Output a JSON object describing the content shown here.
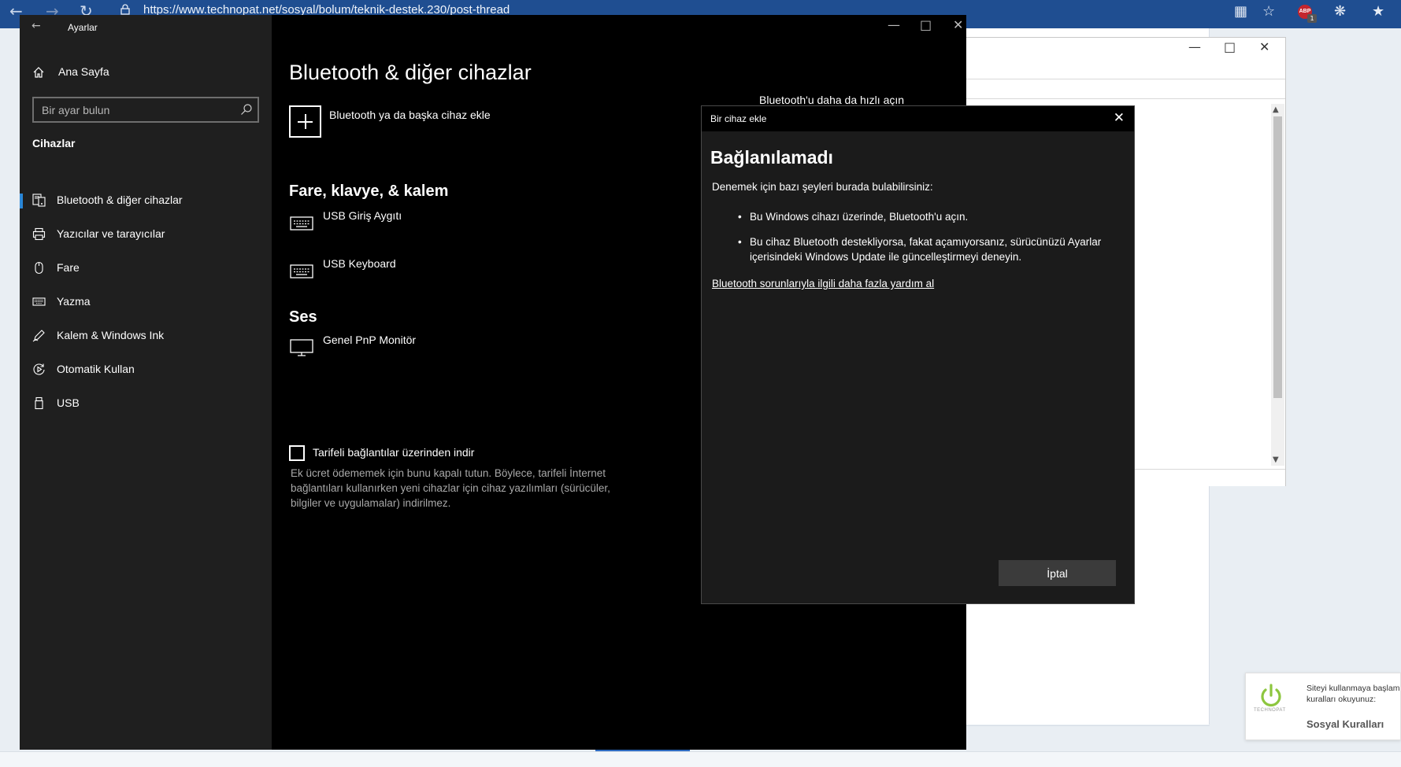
{
  "browser": {
    "url": "https://www.technopat.net/sosyal/bolum/teknik-destek.230/post-thread",
    "abp_label": "ABP",
    "abp_count": "1"
  },
  "settings": {
    "window_title": "Ayarlar",
    "home_label": "Ana Sayfa",
    "search_placeholder": "Bir ayar bulun",
    "group_label": "Cihazlar",
    "nav": [
      {
        "label": "Bluetooth & diğer cihazlar",
        "icon": "bluetooth-devices-icon",
        "selected": true
      },
      {
        "label": "Yazıcılar ve tarayıcılar",
        "icon": "printer-icon",
        "selected": false
      },
      {
        "label": "Fare",
        "icon": "mouse-icon",
        "selected": false
      },
      {
        "label": "Yazma",
        "icon": "keyboard-icon",
        "selected": false
      },
      {
        "label": "Kalem & Windows Ink",
        "icon": "pen-icon",
        "selected": false
      },
      {
        "label": "Otomatik Kullan",
        "icon": "autoplay-icon",
        "selected": false
      },
      {
        "label": "USB",
        "icon": "usb-icon",
        "selected": false
      }
    ],
    "main": {
      "title": "Bluetooth & diğer cihazlar",
      "add_device_label": "Bluetooth ya da başka cihaz ekle",
      "fast_link": "Bluetooth'u daha da hızlı açın",
      "section_input": "Fare, klavye, & kalem",
      "devices_input": [
        "USB Giriş Aygıtı",
        "USB Keyboard"
      ],
      "section_audio": "Ses",
      "devices_audio": [
        "Genel PnP Monitör"
      ],
      "metered_label": "Tarifeli bağlantılar üzerinden indir",
      "metered_checked": false,
      "metered_desc": "Ek ücret ödememek için bunu kapalı tutun. Böylece, tarifeli İnternet bağlantıları kullanırken yeni cihazlar için cihaz yazılımları (sürücüler, bilgiler ve uygulamalar) indirilmez."
    }
  },
  "dialog": {
    "title": "Bir cihaz ekle",
    "heading": "Bağlanılamadı",
    "intro": "Denemek için bazı şeyleri burada bulabilirsiniz:",
    "bullets": [
      "Bu Windows cihazı üzerinde, Bluetooth'u açın.",
      "Bu cihaz Bluetooth destekliyorsa, fakat açamıyorsanız, sürücünüzü Ayarlar içerisindeki Windows Update ile güncelleştirmeyi deneyin."
    ],
    "help_link": "Bluetooth sorunlarıyla ilgili daha fazla yardım al",
    "cancel_label": "İptal"
  },
  "toast": {
    "logo_text": "TECHNOPAT",
    "message_line1": "Siteyi kullanmaya başlamadan önce",
    "message_line2": "kuralları okuyunuz:",
    "cta": "Sosyal Kuralları"
  },
  "colors": {
    "browser_bar": "#1f4e91",
    "settings_sidebar": "#1f1f1f",
    "settings_main": "#000000",
    "accent": "#2a86d6",
    "dialog_bg": "#1b1b1b",
    "toast_logo": "#8dc63f"
  }
}
